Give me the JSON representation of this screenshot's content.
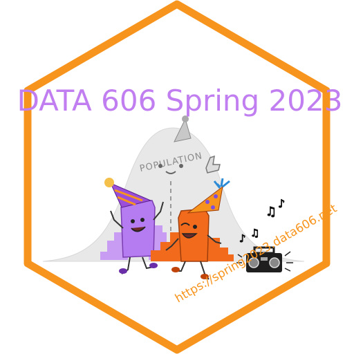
{
  "sticker": {
    "title": "DATA 606 Spring 2023",
    "url": "https://spring2023.data606.net",
    "population_label": "POPULATION",
    "colors": {
      "border": "#f7941d",
      "title": "#c07ef0",
      "url": "#f7941d",
      "purple_sample": "#b57bf0",
      "orange_sample": "#f26b1d",
      "population": "#e4e4e4"
    }
  }
}
